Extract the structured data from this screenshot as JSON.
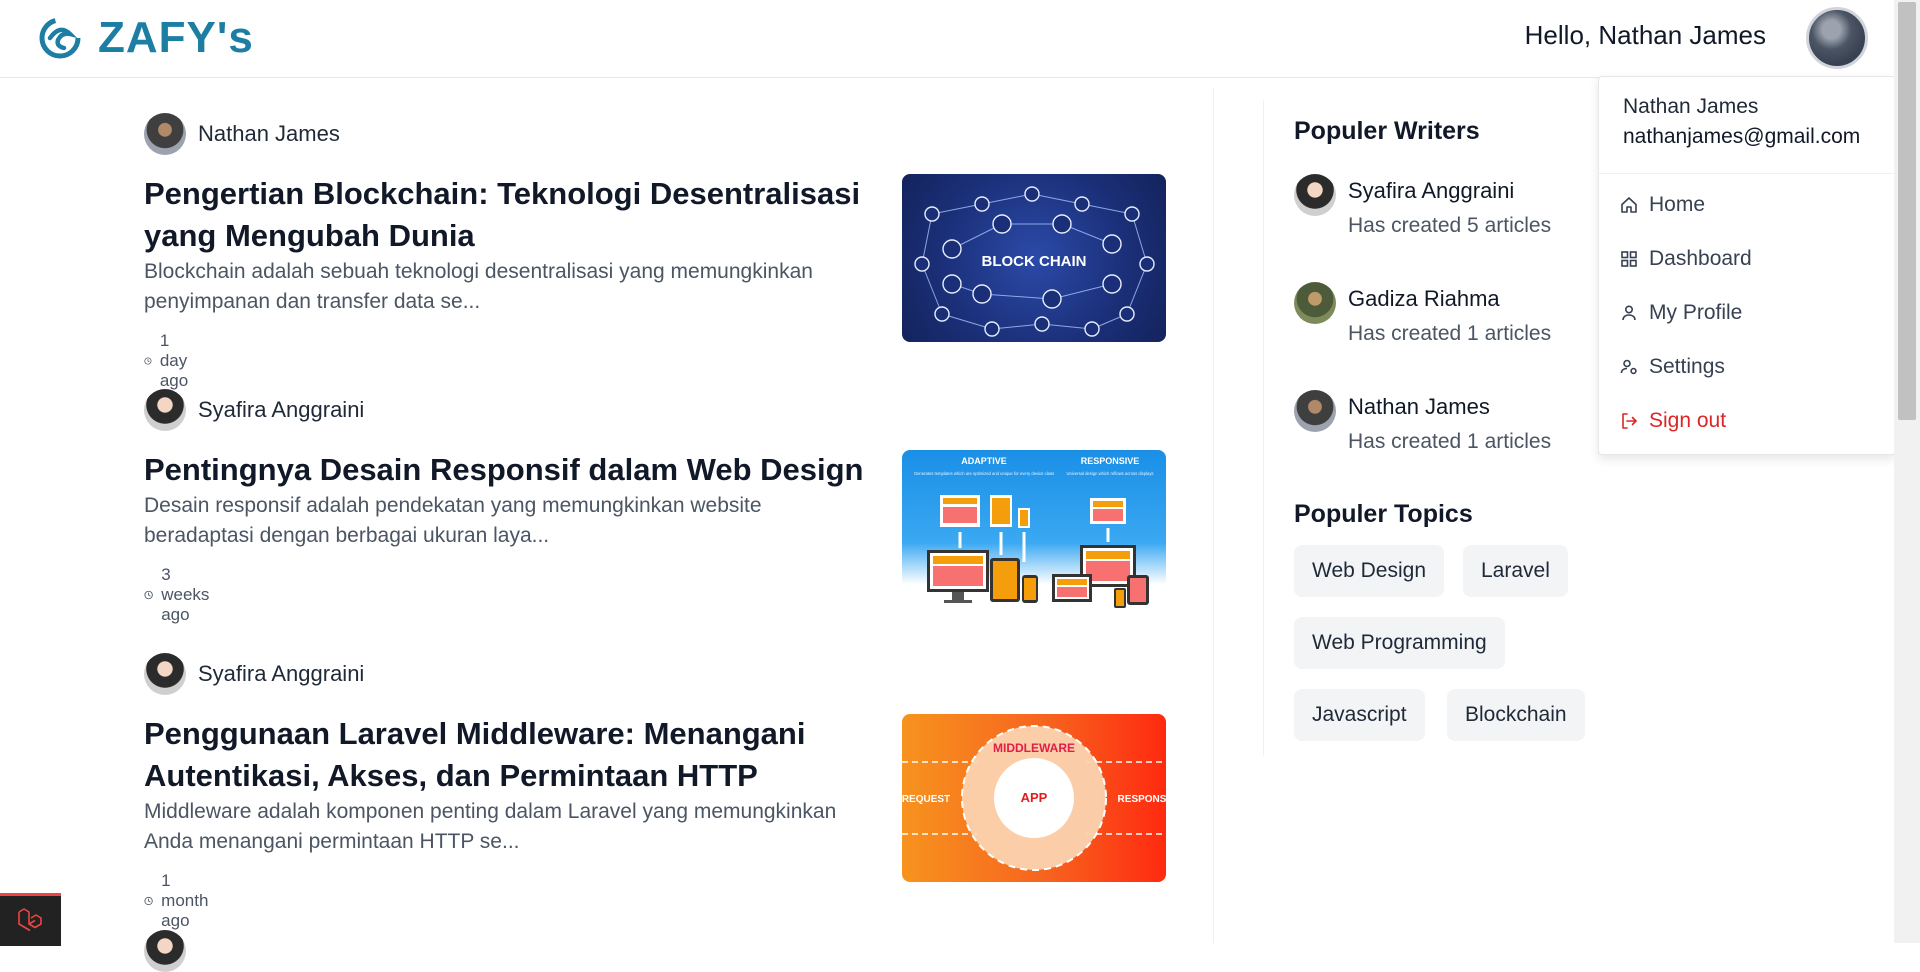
{
  "brand": {
    "name": "ZAFY's",
    "color": "#1d7ea4",
    "logo_icon": "zafy-swirl-icon"
  },
  "header": {
    "greeting": "Hello, Nathan James"
  },
  "articles": [
    {
      "author": "Nathan James",
      "title": "Pengertian Blockchain: Teknologi Desentralisasi yang Mengubah Dunia",
      "excerpt": "Blockchain adalah sebuah teknologi desentralisasi yang memungkinkan penyimpanan dan transfer data se...",
      "time": "1 day ago",
      "thumb_label": "BLOCK CHAIN"
    },
    {
      "author": "Syafira Anggraini",
      "title": "Pentingnya Desain Responsif dalam Web Design",
      "excerpt": "Desain responsif adalah pendekatan yang memungkinkan website beradaptasi dengan berbagai ukuran laya...",
      "time": "3 weeks ago",
      "thumb_left": "ADAPTIVE",
      "thumb_left_sub": "Generates templates which are optimized and unique for every device class",
      "thumb_right": "RESPONSIVE",
      "thumb_right_sub": "Universal design which reflows across displays"
    },
    {
      "author": "Syafira Anggraini",
      "title": "Penggunaan Laravel Middleware: Menangani Autentikasi, Akses, dan Permintaan HTTP",
      "excerpt": "Middleware adalah komponen penting dalam Laravel yang memungkinkan Anda menangani permintaan HTTP se...",
      "time": "1 month ago",
      "thumb_ring": "MIDDLEWARE",
      "thumb_center": "APP",
      "thumb_left": "REQUEST",
      "thumb_right": "RESPONS"
    }
  ],
  "sidebar": {
    "writers_title": "Populer Writers",
    "writers": [
      {
        "name": "Syafira Anggraini",
        "sub": "Has created 5 articles"
      },
      {
        "name": "Gadiza Riahma",
        "sub": "Has created 1 articles"
      },
      {
        "name": "Nathan James",
        "sub": "Has created 1 articles"
      }
    ],
    "topics_title": "Populer Topics",
    "topics": [
      "Web Design",
      "Laravel",
      "Web Programming",
      "Javascript",
      "Blockchain"
    ]
  },
  "user_menu": {
    "name": "Nathan James",
    "email": "nathanjames@gmail.com",
    "items": [
      {
        "label": "Home",
        "icon": "home-icon"
      },
      {
        "label": "Dashboard",
        "icon": "grid-icon"
      },
      {
        "label": "My Profile",
        "icon": "user-icon"
      },
      {
        "label": "Settings",
        "icon": "user-gear-icon"
      },
      {
        "label": "Sign out",
        "icon": "sign-out-icon",
        "color": "#dc2626"
      }
    ]
  }
}
